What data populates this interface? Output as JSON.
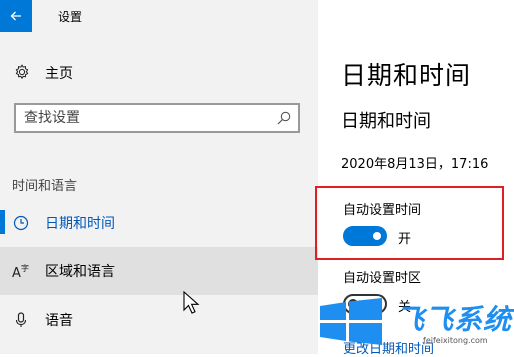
{
  "window": {
    "title": "设置"
  },
  "sidebar": {
    "home_label": "主页",
    "search": {
      "placeholder": "查找设置",
      "value": ""
    },
    "section_header": "时间和语言",
    "items": [
      {
        "label": "日期和时间",
        "icon": "clock-icon",
        "active": true
      },
      {
        "label": "区域和语言",
        "icon": "language-icon",
        "active": false
      },
      {
        "label": "语音",
        "icon": "microphone-icon",
        "active": false
      }
    ]
  },
  "main": {
    "page_title": "日期和时间",
    "section_title": "日期和时间",
    "current_datetime": "2020年8月13日，17:16",
    "auto_time": {
      "label": "自动设置时间",
      "state_label": "开",
      "on": true
    },
    "auto_timezone": {
      "label": "自动设置时区",
      "state_label": "关",
      "on": false
    },
    "change_link": "更改日期和时间"
  },
  "watermark": {
    "text": "飞飞系统",
    "url": "feifeixitong.com"
  },
  "colors": {
    "accent": "#0078d7",
    "highlight_border": "#e02020",
    "sidebar_bg": "#f2f2f2",
    "hover_bg": "#e0e0e0"
  }
}
